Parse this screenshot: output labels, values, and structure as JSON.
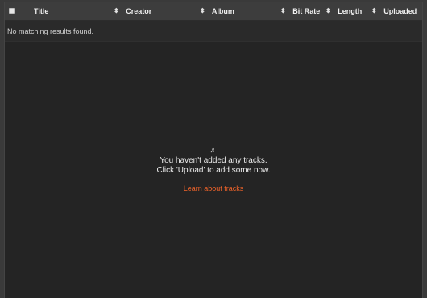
{
  "table": {
    "columns": [
      {
        "label": "Title",
        "sortable": false
      },
      {
        "label": "Creator",
        "sortable": true
      },
      {
        "label": "Album",
        "sortable": true
      },
      {
        "label": "Bit Rate",
        "sortable": true
      },
      {
        "label": "Length",
        "sortable": true
      },
      {
        "label": "Uploaded",
        "sortable": true
      }
    ],
    "no_results": "No matching results found."
  },
  "empty_state": {
    "icon": "music-note-icon",
    "line1": "You haven't added any tracks.",
    "line2": "Click 'Upload' to add some now.",
    "link": "Learn about tracks"
  },
  "colors": {
    "accent": "#f2642a",
    "background": "#242424",
    "header": "#3d3d3d"
  }
}
